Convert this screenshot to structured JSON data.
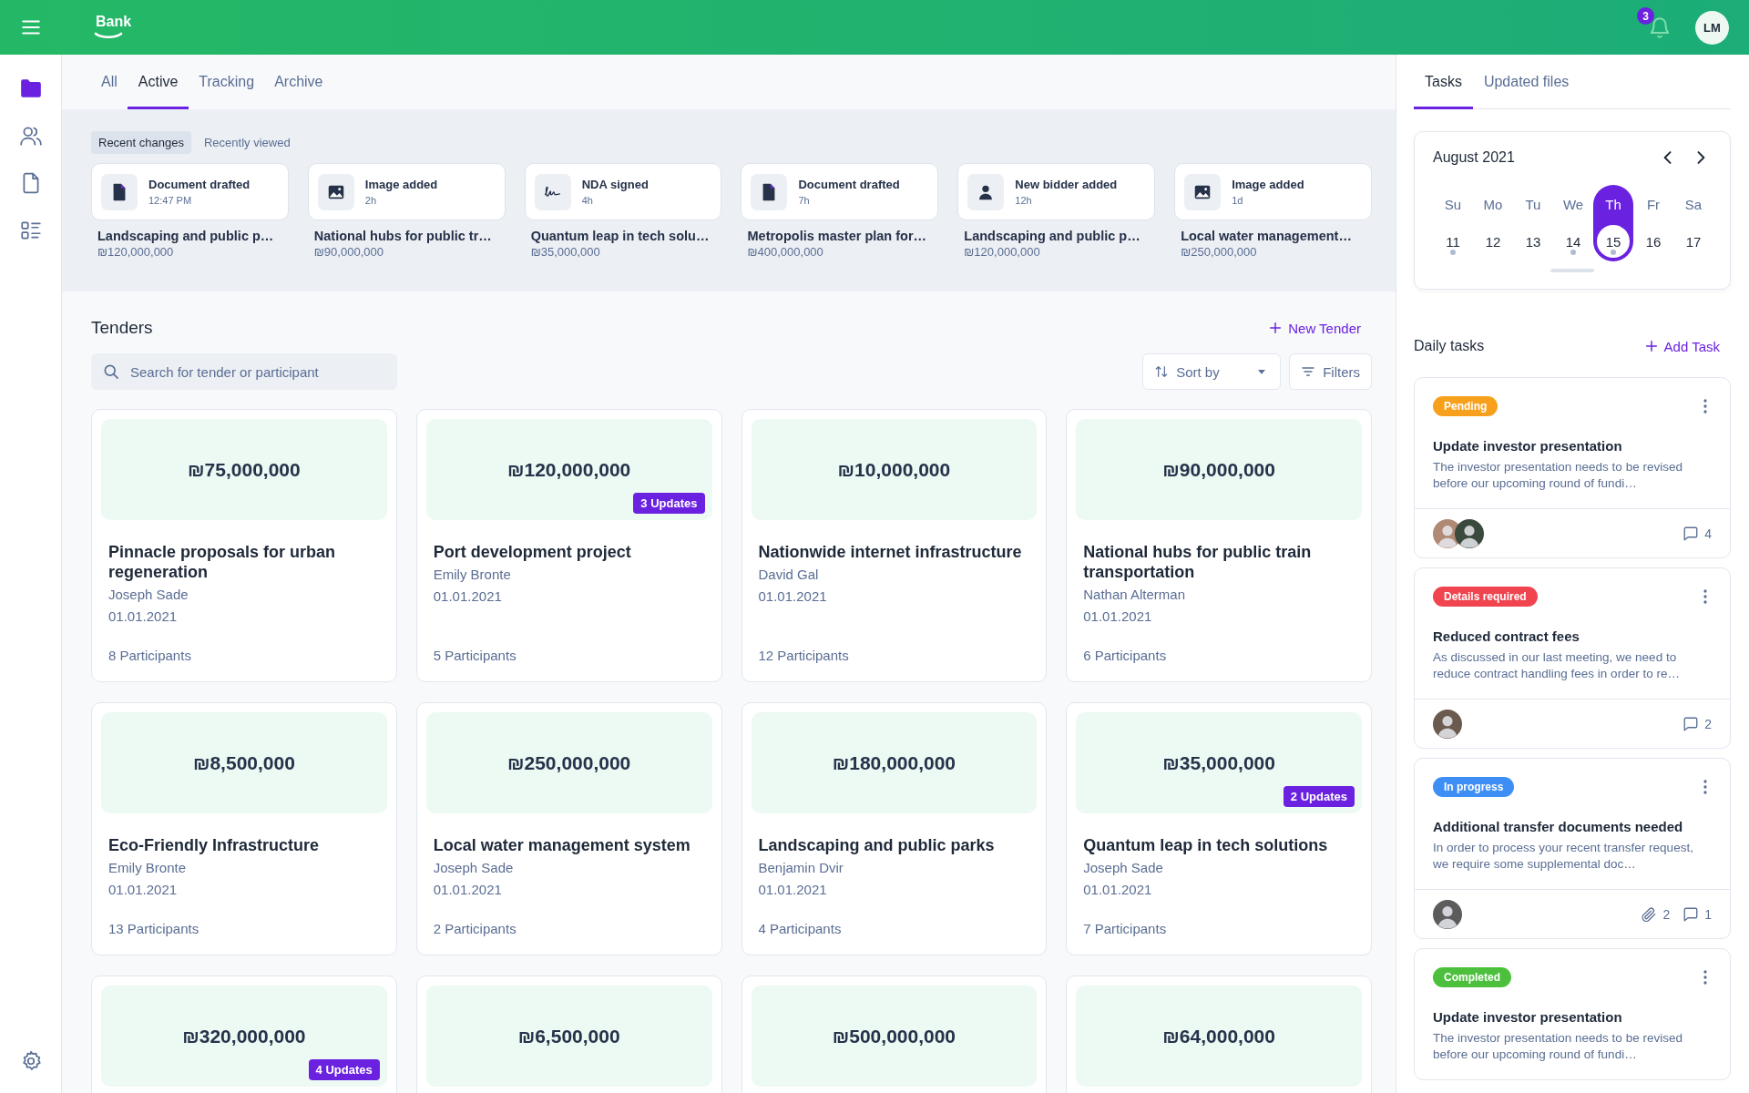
{
  "header": {
    "logo": "Bank",
    "notifications": "3",
    "user_initials": "LM"
  },
  "sidebar": {
    "items": [
      {
        "kind": "folder",
        "selected": true
      },
      {
        "kind": "people",
        "selected": false
      },
      {
        "kind": "file",
        "selected": false
      },
      {
        "kind": "list",
        "selected": false
      }
    ],
    "settings": {
      "kind": "settings",
      "selected": false
    }
  },
  "tabs": [
    {
      "label": "All",
      "selected": false
    },
    {
      "label": "Active",
      "selected": true
    },
    {
      "label": "Tracking",
      "selected": false
    },
    {
      "label": "Archive",
      "selected": false
    }
  ],
  "recent": {
    "toggles": [
      {
        "label": "Recent changes",
        "selected": true
      },
      {
        "label": "Recently viewed",
        "selected": false
      }
    ],
    "items": [
      {
        "kind": "document",
        "event": "Document drafted",
        "time": "12:47 PM",
        "title": "Landscaping and public p…",
        "amount": "₪120,000,000"
      },
      {
        "kind": "image",
        "event": "Image added",
        "time": "2h",
        "title": "National hubs for public tr…",
        "amount": "₪90,000,000"
      },
      {
        "kind": "signature",
        "event": "NDA signed",
        "time": "4h",
        "title": "Quantum leap in tech solu…",
        "amount": "₪35,000,000"
      },
      {
        "kind": "document",
        "event": "Document drafted",
        "time": "7h",
        "title": "Metropolis master plan for…",
        "amount": "₪400,000,000"
      },
      {
        "kind": "person",
        "event": "New bidder added",
        "time": "12h",
        "title": "Landscaping and public p…",
        "amount": "₪120,000,000"
      },
      {
        "kind": "image",
        "event": "Image added",
        "time": "1d",
        "title": "Local water management…",
        "amount": "₪250,000,000"
      }
    ]
  },
  "tenders": {
    "title": "Tenders",
    "new_button": "New Tender",
    "search": {
      "placeholder": "Search for tender or participant"
    },
    "sort": "Sort by",
    "filters": "Filters",
    "cards": [
      {
        "amount": "₪75,000,000",
        "title": "Pinnacle proposals for urban regeneration",
        "owner": "Joseph Sade",
        "date": "01.01.2021",
        "participants": "8 Participants"
      },
      {
        "amount": "₪120,000,000",
        "updates": "3 Updates",
        "title": "Port development project",
        "owner": "Emily Bronte",
        "date": "01.01.2021",
        "participants": "5 Participants"
      },
      {
        "amount": "₪10,000,000",
        "title": "Nationwide internet infrastructure",
        "owner": "David Gal",
        "date": "01.01.2021",
        "participants": "12 Participants"
      },
      {
        "amount": "₪90,000,000",
        "title": "National hubs for public train transportation",
        "owner": "Nathan Alterman",
        "date": "01.01.2021",
        "participants": "6 Participants"
      },
      {
        "amount": "₪8,500,000",
        "title": "Eco-Friendly Infrastructure",
        "owner": "Emily Bronte",
        "date": "01.01.2021",
        "participants": "13 Participants"
      },
      {
        "amount": "₪250,000,000",
        "title": "Local water management system",
        "owner": "Joseph Sade",
        "date": "01.01.2021",
        "participants": "2 Participants"
      },
      {
        "amount": "₪180,000,000",
        "title": "Landscaping and public parks",
        "owner": "Benjamin Dvir",
        "date": "01.01.2021",
        "participants": "4 Participants"
      },
      {
        "amount": "₪35,000,000",
        "updates": "2 Updates",
        "title": "Quantum leap in tech solutions",
        "owner": "Joseph Sade",
        "date": "01.01.2021",
        "participants": "7 Participants"
      },
      {
        "amount": "₪320,000,000",
        "updates": "4 Updates"
      },
      {
        "amount": "₪6,500,000"
      },
      {
        "amount": "₪500,000,000"
      },
      {
        "amount": "₪64,000,000"
      }
    ]
  },
  "right_tabs": [
    {
      "label": "Tasks",
      "selected": true
    },
    {
      "label": "Updated files",
      "selected": false
    }
  ],
  "calendar": {
    "month": "August 2021",
    "days": [
      {
        "weekday": "Su",
        "day": "11",
        "selected": false,
        "has_events": true
      },
      {
        "weekday": "Mo",
        "day": "12",
        "selected": false,
        "has_events": false
      },
      {
        "weekday": "Tu",
        "day": "13",
        "selected": false,
        "has_events": false
      },
      {
        "weekday": "We",
        "day": "14",
        "selected": false,
        "has_events": true
      },
      {
        "weekday": "Th",
        "day": "15",
        "selected": true,
        "has_events": true
      },
      {
        "weekday": "Fr",
        "day": "16",
        "selected": false,
        "has_events": false
      },
      {
        "weekday": "Sa",
        "day": "17",
        "selected": false,
        "has_events": false
      }
    ]
  },
  "daily_tasks": {
    "title": "Daily tasks",
    "add_button": "Add Task",
    "tasks": [
      {
        "status": "Pending",
        "color": "#f7a01c",
        "title": "Update investor presentation",
        "description": "The investor presentation needs to be revised before our upcoming round of fundi…",
        "avatars": [
          {
            "color": "#b08a74"
          },
          {
            "color": "#3a4a3c"
          }
        ],
        "comments": "4"
      },
      {
        "status": "Details required",
        "color": "#f0444f",
        "title": "Reduced contract fees",
        "description": "As discussed in our last meeting, we need to reduce contract handling fees in order to re…",
        "avatars": [
          {
            "color": "#6b5a4e"
          }
        ],
        "comments": "2"
      },
      {
        "status": "In progress",
        "color": "#3d8ff5",
        "title": "Additional transfer documents needed",
        "description": "In order to process your recent transfer request, we require some supplemental doc…",
        "avatars": [
          {
            "color": "#5c5c5c"
          }
        ],
        "attachments": "2",
        "comments": "1"
      },
      {
        "status": "Completed",
        "color": "#4cbf3c",
        "title": "Update investor presentation",
        "description": "The investor presentation needs to be revised before our upcoming round of fundi…"
      }
    ]
  }
}
